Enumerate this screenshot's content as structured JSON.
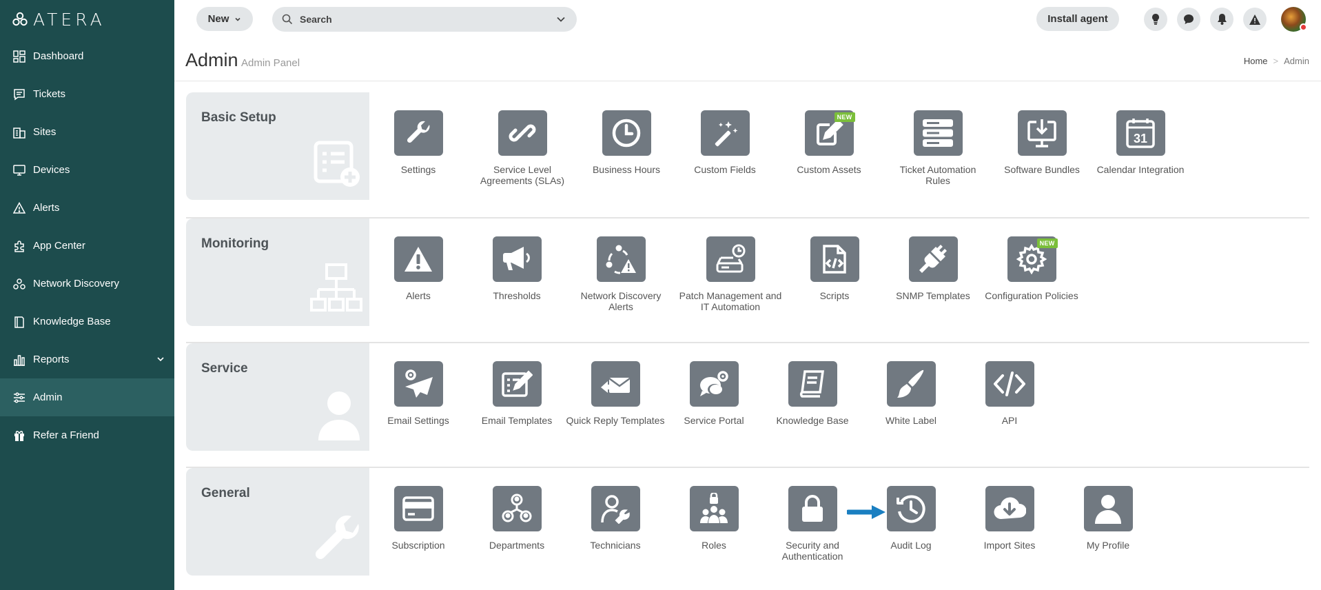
{
  "sidebar": {
    "logo": "ATERA",
    "items": [
      {
        "label": "Dashboard",
        "icon": "dashboard-icon"
      },
      {
        "label": "Tickets",
        "icon": "ticket-icon"
      },
      {
        "label": "Sites",
        "icon": "sites-icon"
      },
      {
        "label": "Devices",
        "icon": "devices-icon"
      },
      {
        "label": "Alerts",
        "icon": "alert-icon"
      },
      {
        "label": "App Center",
        "icon": "app-center-icon"
      },
      {
        "label": "Network Discovery",
        "icon": "network-discovery-icon"
      },
      {
        "label": "Knowledge Base",
        "icon": "knowledge-base-icon"
      },
      {
        "label": "Reports",
        "icon": "reports-icon"
      },
      {
        "label": "Admin",
        "icon": "admin-icon",
        "active": true
      },
      {
        "label": "Refer a Friend",
        "icon": "gift-icon"
      }
    ]
  },
  "topbar": {
    "new_label": "New",
    "search_placeholder": "Search",
    "install_label": "Install agent"
  },
  "header": {
    "title": "Admin",
    "subtitle": "Admin Panel",
    "breadcrumb": {
      "home": "Home",
      "sep": ">",
      "current": "Admin"
    }
  },
  "sections": {
    "basic": {
      "title": "Basic Setup",
      "tiles": [
        {
          "label": "Settings"
        },
        {
          "label": "Service Level Agreements (SLAs)"
        },
        {
          "label": "Business Hours"
        },
        {
          "label": "Custom Fields"
        },
        {
          "label": "Custom Assets",
          "badge": "NEW"
        },
        {
          "label": "Ticket Automation Rules"
        },
        {
          "label": "Software Bundles"
        },
        {
          "label": "Calendar Integration",
          "calendar_day": "31"
        }
      ]
    },
    "monitoring": {
      "title": "Monitoring",
      "tiles": [
        {
          "label": "Alerts"
        },
        {
          "label": "Thresholds"
        },
        {
          "label": "Network Discovery Alerts"
        },
        {
          "label": "Patch Management and IT Automation"
        },
        {
          "label": "Scripts"
        },
        {
          "label": "SNMP Templates"
        },
        {
          "label": "Configuration Policies",
          "badge": "NEW"
        }
      ]
    },
    "service": {
      "title": "Service",
      "tiles": [
        {
          "label": "Email Settings"
        },
        {
          "label": "Email Templates"
        },
        {
          "label": "Quick Reply Templates"
        },
        {
          "label": "Service Portal"
        },
        {
          "label": "Knowledge Base"
        },
        {
          "label": "White Label"
        },
        {
          "label": "API"
        }
      ]
    },
    "general": {
      "title": "General",
      "tiles": [
        {
          "label": "Subscription"
        },
        {
          "label": "Departments"
        },
        {
          "label": "Technicians"
        },
        {
          "label": "Roles"
        },
        {
          "label": "Security and Authentication"
        },
        {
          "label": "Audit Log"
        },
        {
          "label": "Import Sites"
        },
        {
          "label": "My Profile"
        }
      ]
    }
  },
  "colors": {
    "sidebar_bg": "#1d4c4d",
    "sidebar_active": "#2c6061",
    "tile_icon_bg": "#717981",
    "badge_new": "#7bbf3a",
    "arrow": "#1a7fc1"
  }
}
